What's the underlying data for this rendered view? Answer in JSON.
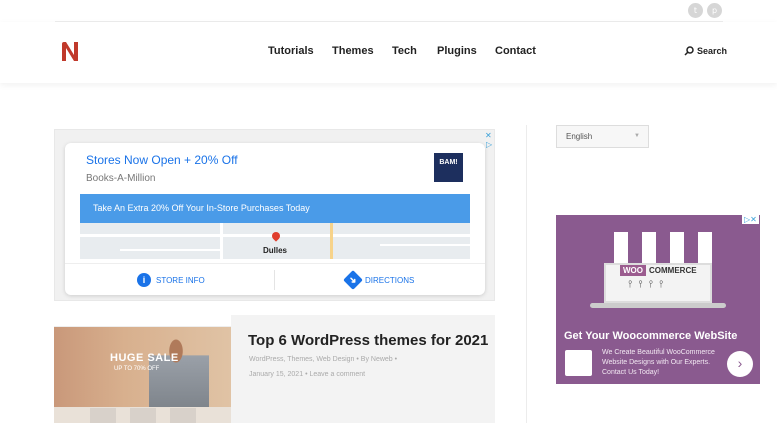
{
  "nav": {
    "items": [
      "Tutorials",
      "Themes",
      "Tech",
      "Plugins",
      "Contact"
    ],
    "search_label": "Search"
  },
  "social": [
    "twitter-icon",
    "pinterest-icon"
  ],
  "ad_top": {
    "title": "Stores Now Open + 20% Off",
    "subtitle": "Books-A-Million",
    "brand": "BAM!",
    "banner": "Take An Extra 20% Off Your In-Store Purchases Today",
    "map_label": "Dulles",
    "store_info": "STORE INFO",
    "directions": "DIRECTIONS"
  },
  "post": {
    "title": "Top 6 WordPress themes for 2021",
    "categories": "WordPress, Themes, Web Design",
    "author": "By Neweb",
    "date": "January 15, 2021",
    "comment": "Leave a comment",
    "thumb_sale": "HUGE SALE",
    "thumb_sale_sub": "UP TO 70% OFF"
  },
  "sidebar": {
    "language": "English",
    "ad": {
      "brand_badge": "WOO",
      "brand_text": "COMMERCE",
      "headline": "Get Your Woocommerce WebSite",
      "body": "We Create Beautiful WooCommerce Website Designs with Our Experts. Contact Us Today!"
    }
  },
  "colors": {
    "accent": "#1a73e8",
    "ad_purple": "#8a5a8f",
    "logo_red": "#c0392b"
  }
}
